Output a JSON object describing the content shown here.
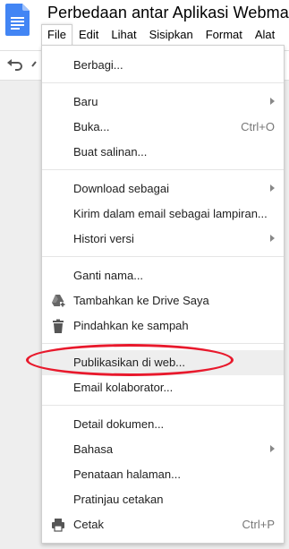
{
  "document": {
    "title": "Perbedaan antar Aplikasi Webmai"
  },
  "menubar": {
    "items": [
      "File",
      "Edit",
      "Lihat",
      "Sisipkan",
      "Format",
      "Alat"
    ],
    "active": "File"
  },
  "file_menu": {
    "share": "Berbagi...",
    "new": "Baru",
    "open": "Buka...",
    "open_shortcut": "Ctrl+O",
    "make_copy": "Buat salinan...",
    "download_as": "Download sebagai",
    "email_attachment": "Kirim dalam email sebagai lampiran...",
    "version_history": "Histori versi",
    "rename": "Ganti nama...",
    "add_to_drive": "Tambahkan ke Drive Saya",
    "move_to_trash": "Pindahkan ke sampah",
    "publish_to_web": "Publikasikan di web...",
    "email_collaborators": "Email kolaborator...",
    "document_details": "Detail dokumen...",
    "language": "Bahasa",
    "page_setup": "Penataan halaman...",
    "print_preview": "Pratinjau cetakan",
    "print": "Cetak",
    "print_shortcut": "Ctrl+P"
  },
  "icons": {
    "app": "google-docs-icon",
    "undo": "undo-icon",
    "drive": "drive-add-icon",
    "trash": "trash-icon",
    "print": "printer-icon"
  },
  "colors": {
    "docs_blue": "#4285f4",
    "annotation_red": "#e8192c",
    "hover_bg": "#eeeeee"
  }
}
